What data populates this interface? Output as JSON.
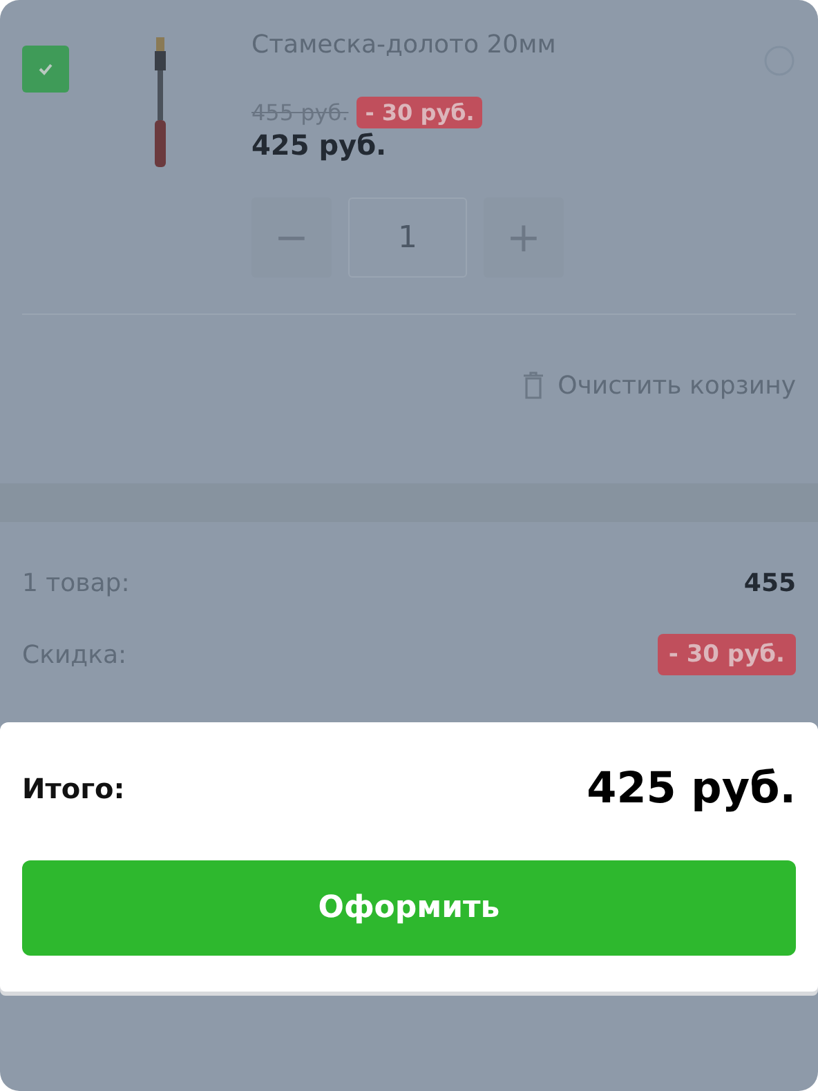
{
  "cart": {
    "items": [
      {
        "checked": true,
        "title": "Стамеска-долото 20мм",
        "old_price": "455 руб.",
        "discount": "- 30 руб.",
        "price": "425 руб.",
        "minus": "−",
        "quantity": "1",
        "plus": "+"
      }
    ],
    "clear_label": "Очистить корзину"
  },
  "summary": {
    "rows": [
      {
        "kind": "plain",
        "label": "1 товар:",
        "value": "455"
      },
      {
        "kind": "badge",
        "label": "Скидка:",
        "value": "- 30 руб."
      }
    ]
  },
  "checkout": {
    "total_label": "Итого:",
    "total": "425 руб.",
    "button": "Оформить"
  }
}
